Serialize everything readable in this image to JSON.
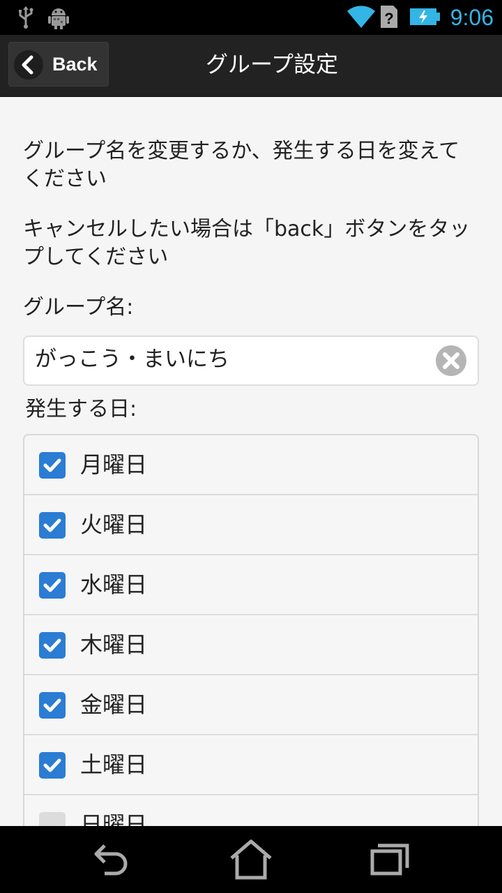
{
  "status_bar": {
    "time": "9:06",
    "icons": [
      "usb-icon",
      "android-debug-icon",
      "wifi-icon",
      "no-sim-icon",
      "battery-charging-icon"
    ],
    "time_color": "#33b5e5"
  },
  "header": {
    "back_label": "Back",
    "title": "グループ設定"
  },
  "main": {
    "instruction_1": "グループ名を変更するか、発生する日を変えてください",
    "instruction_2": "キャンセルしたい場合は「back」ボタンをタップしてください",
    "group_name_label": "グループ名:",
    "group_name_value": "がっこう・まいにち",
    "days_label": "発生する日:",
    "days": [
      {
        "label": "月曜日",
        "checked": true
      },
      {
        "label": "火曜日",
        "checked": true
      },
      {
        "label": "水曜日",
        "checked": true
      },
      {
        "label": "木曜日",
        "checked": true
      },
      {
        "label": "金曜日",
        "checked": true
      },
      {
        "label": "土曜日",
        "checked": true
      },
      {
        "label": "日曜日",
        "checked": false
      }
    ]
  },
  "nav_bar": {
    "icons": [
      "back-nav-icon",
      "home-nav-icon",
      "recents-nav-icon"
    ]
  },
  "colors": {
    "accent": "#2b7cd3",
    "header_bg": "#222222",
    "page_bg": "#f5f5f5"
  }
}
